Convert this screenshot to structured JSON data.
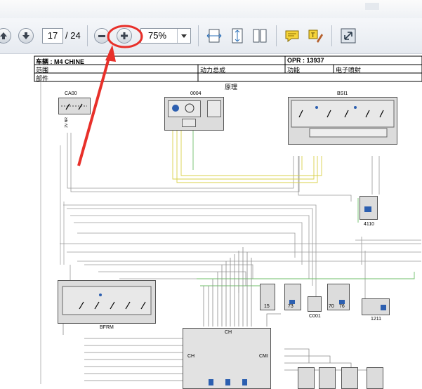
{
  "toolbar": {
    "page_current": "17",
    "page_total": "/ 24",
    "zoom": "75%",
    "icons": [
      "up-arrow-icon",
      "down-arrow-icon",
      "zoom-out-icon",
      "zoom-in-icon",
      "dropdown-icon",
      "fit-width-icon",
      "fit-page-icon",
      "two-page-icon",
      "comment-icon",
      "highlight-icon",
      "fullscreen-icon"
    ]
  },
  "header": {
    "vehicle": "车辆 : M4 CHINE",
    "opr": "OPR : 13937",
    "domain": "范围",
    "category": "动力总成",
    "function": "功能",
    "function_value": "电子喷射",
    "part": "部件",
    "principle": "原理"
  },
  "components": {
    "ca00": "CA00",
    "c0004": "0004",
    "bsi1": "BSI1",
    "c4110": "4110",
    "bfrm": "BFRM",
    "c1211": "1211",
    "c0001": "C001",
    "ch": "CH",
    "cmi": "CMI",
    "c15": "15",
    "c73": "73",
    "c70": "70",
    "c76": "76"
  },
  "annotation_color": "#e8302a"
}
